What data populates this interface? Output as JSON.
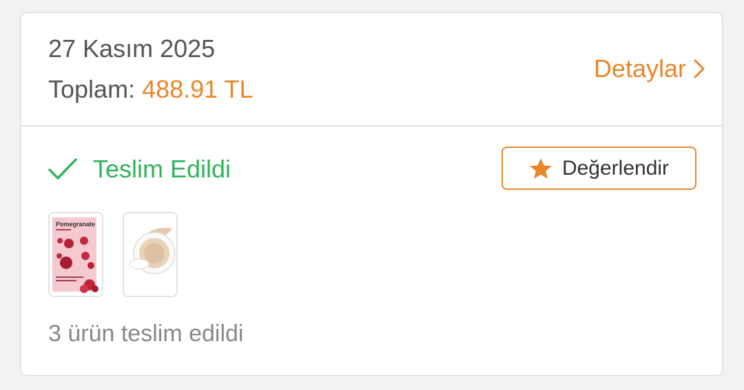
{
  "order": {
    "date": "27 Kasım 2025",
    "total_label": "Toplam:",
    "total_value": "488.91 TL",
    "details_label": "Detaylar"
  },
  "status": {
    "text": "Teslim Edildi",
    "rate_label": "Değerlendir",
    "summary": "3 ürün teslim edildi"
  },
  "products": [
    {
      "name": "Pomegranate",
      "icon": "sheet-mask-product-image"
    },
    {
      "name": "",
      "icon": "cushion-compact-product-image"
    }
  ],
  "colors": {
    "accent": "#e8862a",
    "success": "#2fb45a",
    "text_primary": "#555555",
    "text_muted": "#888888",
    "border": "#e3e3e3"
  },
  "icons": {
    "details": "chevron-right-icon",
    "status": "check-icon",
    "rate": "star-icon"
  }
}
